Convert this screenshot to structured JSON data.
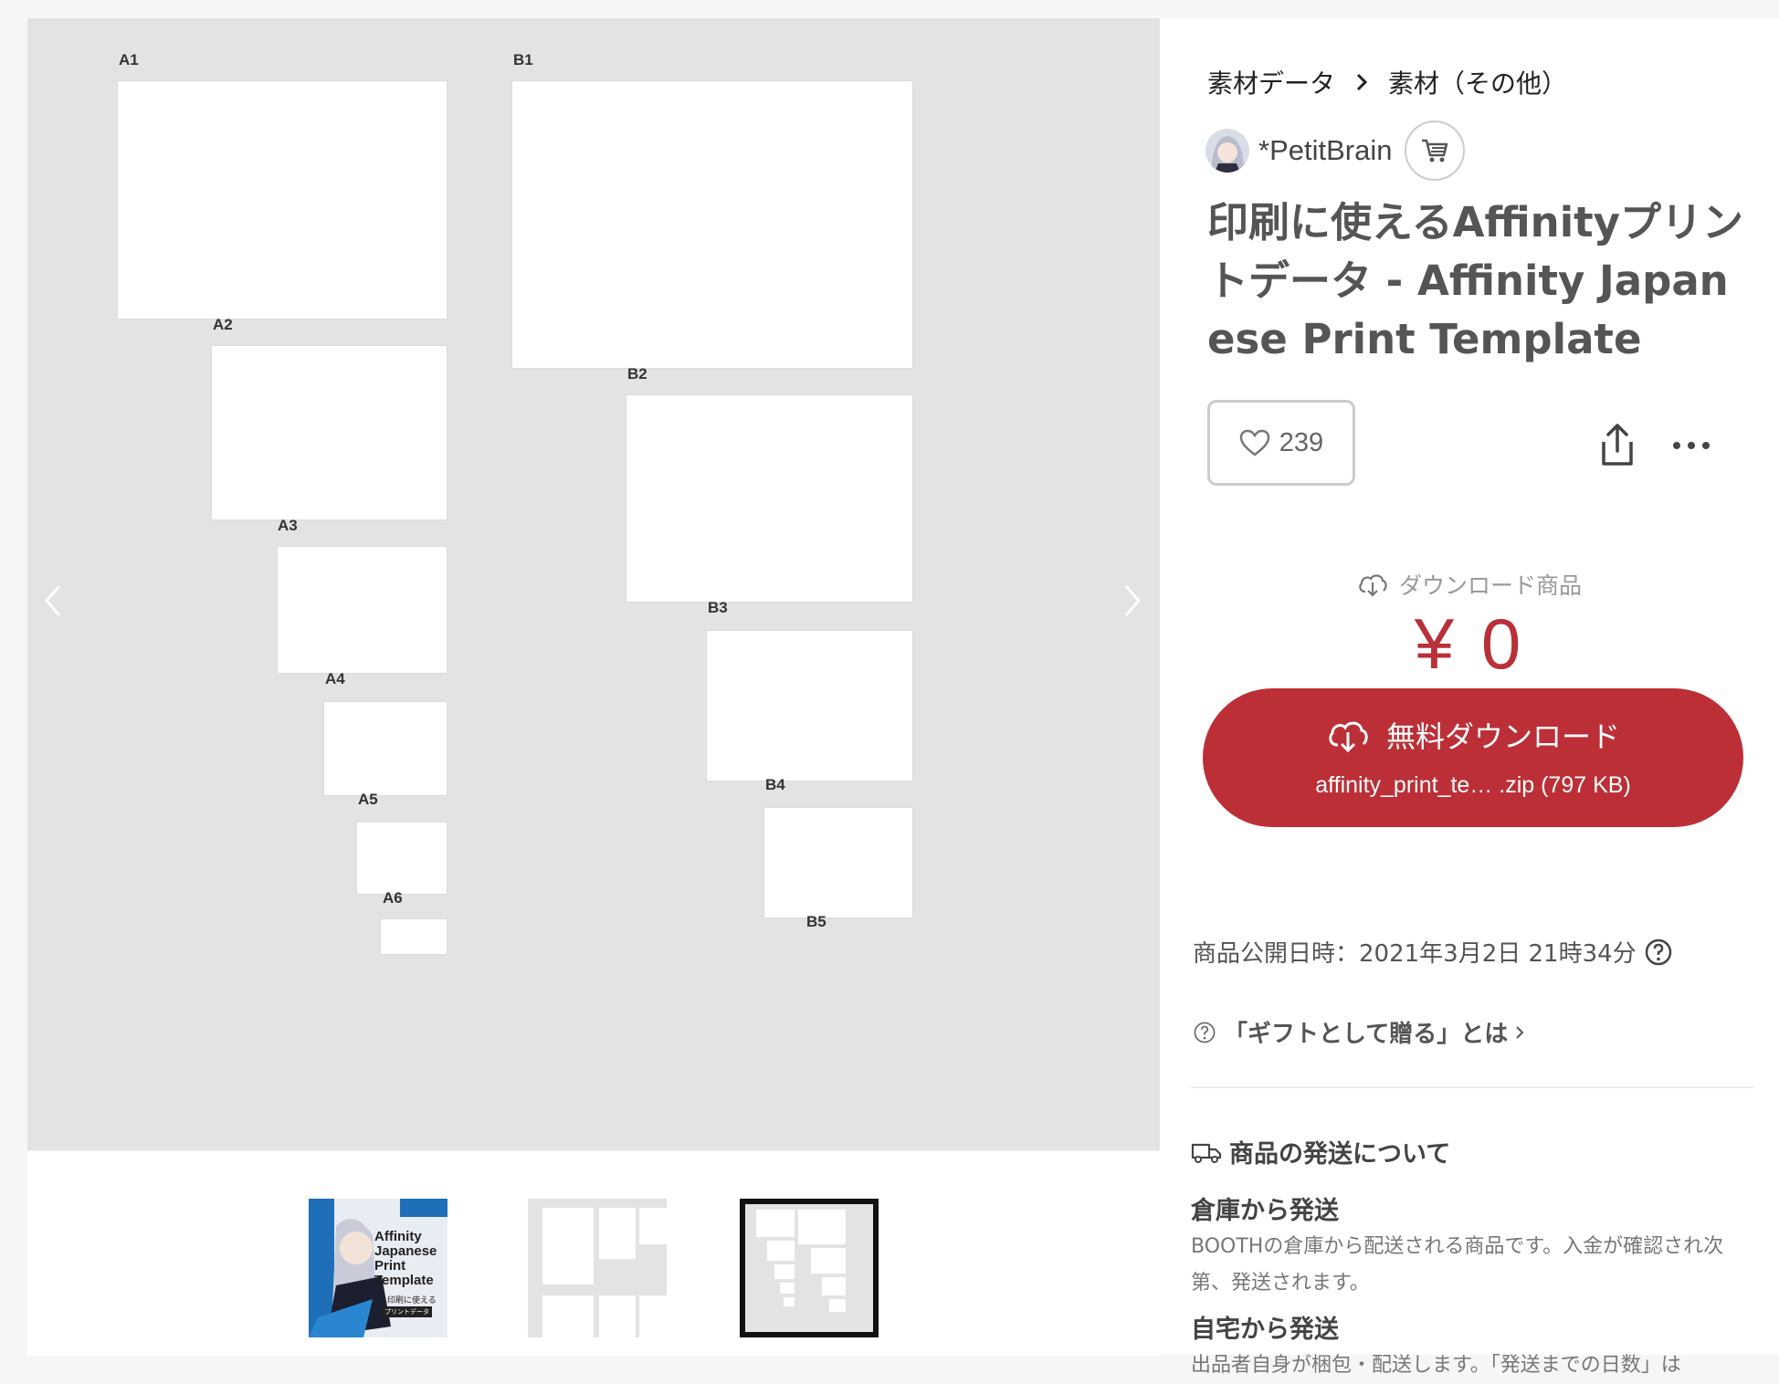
{
  "gallery": {
    "a_sizes": [
      "A1",
      "A2",
      "A3",
      "A4",
      "A5",
      "A6"
    ],
    "b_sizes": [
      "B1",
      "B2",
      "B3",
      "B4",
      "B5"
    ],
    "prev_icon": "chevron-left-icon",
    "next_icon": "chevron-right-icon",
    "thumbnail1": {
      "lines": [
        "Affinity",
        "Japanese",
        "Print",
        "Template"
      ],
      "badge": "印刷に使える",
      "badge2": "プリントデータ"
    }
  },
  "breadcrumb": {
    "category": "素材データ",
    "subcategory": "素材（その他）"
  },
  "shop": {
    "name": "*PetitBrain",
    "cart_icon": "cart-icon"
  },
  "product": {
    "title": "印刷に使えるAffinityプリントデータ - Affinity Japanese Print Template",
    "likes": "239",
    "download_type": "ダウンロード商品",
    "price": "¥ 0",
    "download_button": {
      "label": "無料ダウンロード",
      "file": "affinity_print_te…  .zip (797 KB)"
    },
    "published": "商品公開日時：2021年3月2日 21時34分",
    "gift_link": "「ギフトとして贈る」とは"
  },
  "shipping": {
    "heading": "商品の発送について",
    "warehouse_title": "倉庫から発送",
    "warehouse_text": "BOOTHの倉庫から配送される商品です。入金が確認され次第、発送されます。",
    "home_title": "自宅から発送",
    "home_text": "出品者自身が梱包・配送します。「発送までの日数」は"
  },
  "colors": {
    "accent": "#bc2f37",
    "viewer_bg": "#e3e3e3"
  }
}
